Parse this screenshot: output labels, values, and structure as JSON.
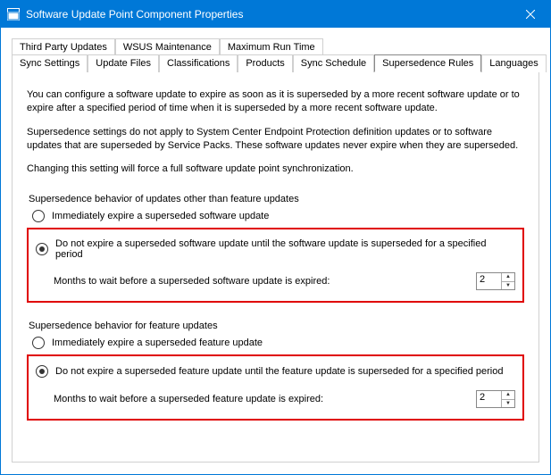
{
  "window": {
    "title": "Software Update Point Component Properties"
  },
  "tabs_row1": [
    {
      "label": "Third Party Updates"
    },
    {
      "label": "WSUS Maintenance"
    },
    {
      "label": "Maximum Run Time"
    }
  ],
  "tabs_row2": [
    {
      "label": "Sync Settings"
    },
    {
      "label": "Update Files"
    },
    {
      "label": "Classifications"
    },
    {
      "label": "Products"
    },
    {
      "label": "Sync Schedule"
    },
    {
      "label": "Supersedence Rules"
    },
    {
      "label": "Languages"
    }
  ],
  "intro": {
    "p1": "You can configure a software update to expire as soon as it is superseded by a more recent software update or to expire after a specified period of time when it is superseded by a more recent software update.",
    "p2": "Supersedence settings do not apply to System Center Endpoint Protection definition updates or to software updates that are superseded by Service Packs. These software updates never expire when they are superseded.",
    "p3": "Changing this setting will force a full software update point synchronization."
  },
  "group1": {
    "label": "Supersedence behavior of updates other than feature updates",
    "opt_immediate": "Immediately expire a superseded software update",
    "opt_wait": "Do not expire a superseded software update until the software update is superseded for a specified period",
    "months_label": "Months to wait before a superseded software update is expired:",
    "months_value": "2"
  },
  "group2": {
    "label": "Supersedence behavior for feature updates",
    "opt_immediate": "Immediately expire a superseded feature update",
    "opt_wait": "Do not expire a superseded feature update until the feature update is superseded for a specified period",
    "months_label": "Months to wait before a superseded feature update is expired:",
    "months_value": "2"
  }
}
